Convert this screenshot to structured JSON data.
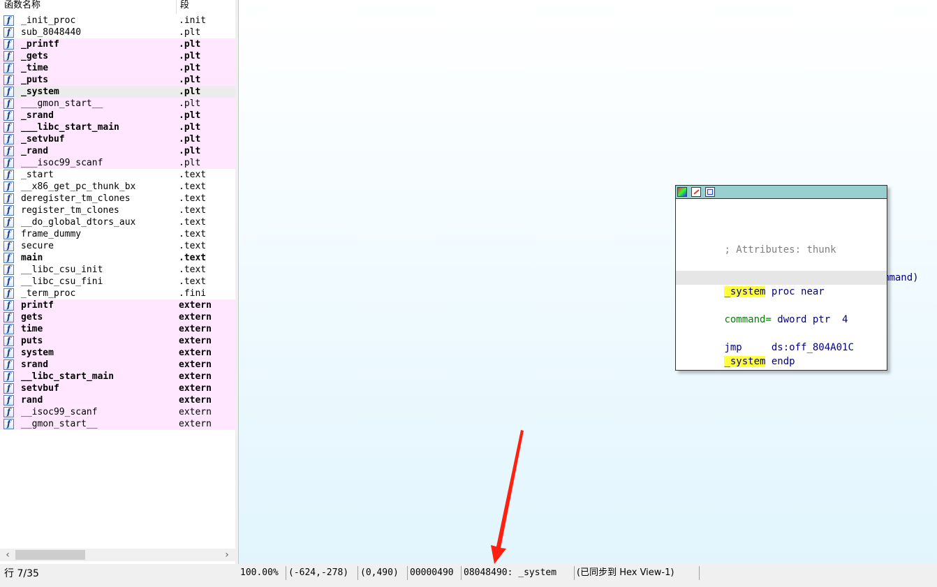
{
  "func_panel": {
    "header": {
      "name_col": "函数名称",
      "segment_col": "段"
    },
    "rows": [
      {
        "name": "_init_proc",
        "segment": ".init",
        "style": "normal"
      },
      {
        "name": "sub_8048440",
        "segment": ".plt",
        "style": "normal"
      },
      {
        "name": "_printf",
        "segment": ".plt",
        "style": "pink-bold"
      },
      {
        "name": "_gets",
        "segment": ".plt",
        "style": "pink-bold"
      },
      {
        "name": "_time",
        "segment": ".plt",
        "style": "pink-bold"
      },
      {
        "name": "_puts",
        "segment": ".plt",
        "style": "pink-bold"
      },
      {
        "name": "_system",
        "segment": ".plt",
        "style": "selected-bold"
      },
      {
        "name": "___gmon_start__",
        "segment": ".plt",
        "style": "pink"
      },
      {
        "name": "_srand",
        "segment": ".plt",
        "style": "pink-bold"
      },
      {
        "name": "___libc_start_main",
        "segment": ".plt",
        "style": "pink-bold"
      },
      {
        "name": "_setvbuf",
        "segment": ".plt",
        "style": "pink-bold"
      },
      {
        "name": "_rand",
        "segment": ".plt",
        "style": "pink-bold"
      },
      {
        "name": "___isoc99_scanf",
        "segment": ".plt",
        "style": "pink"
      },
      {
        "name": "_start",
        "segment": ".text",
        "style": "normal"
      },
      {
        "name": "__x86_get_pc_thunk_bx",
        "segment": ".text",
        "style": "normal"
      },
      {
        "name": "deregister_tm_clones",
        "segment": ".text",
        "style": "normal"
      },
      {
        "name": "register_tm_clones",
        "segment": ".text",
        "style": "normal"
      },
      {
        "name": "__do_global_dtors_aux",
        "segment": ".text",
        "style": "normal"
      },
      {
        "name": "frame_dummy",
        "segment": ".text",
        "style": "normal"
      },
      {
        "name": "secure",
        "segment": ".text",
        "style": "normal"
      },
      {
        "name": "main",
        "segment": ".text",
        "style": "bold"
      },
      {
        "name": "__libc_csu_init",
        "segment": ".text",
        "style": "normal"
      },
      {
        "name": "__libc_csu_fini",
        "segment": ".text",
        "style": "normal"
      },
      {
        "name": "_term_proc",
        "segment": ".fini",
        "style": "normal"
      },
      {
        "name": "printf",
        "segment": "extern",
        "style": "pink-bold"
      },
      {
        "name": "gets",
        "segment": "extern",
        "style": "pink-bold"
      },
      {
        "name": "time",
        "segment": "extern",
        "style": "pink-bold"
      },
      {
        "name": "puts",
        "segment": "extern",
        "style": "pink-bold"
      },
      {
        "name": "system",
        "segment": "extern",
        "style": "pink-bold"
      },
      {
        "name": "srand",
        "segment": "extern",
        "style": "pink-bold"
      },
      {
        "name": "__libc_start_main",
        "segment": "extern",
        "style": "pink-bold"
      },
      {
        "name": "setvbuf",
        "segment": "extern",
        "style": "pink-bold"
      },
      {
        "name": "rand",
        "segment": "extern",
        "style": "pink-bold"
      },
      {
        "name": "__isoc99_scanf",
        "segment": "extern",
        "style": "pink"
      },
      {
        "name": "__gmon_start__",
        "segment": "extern",
        "style": "pink"
      }
    ],
    "icon_glyph": "f",
    "row_status": "行 7/35",
    "scroll_left": "‹",
    "scroll_right": "›"
  },
  "code_node": {
    "attributes": "; Attributes: thunk",
    "signature": "; int system(const char *command)",
    "proc_name": "_system",
    "proc_kw": " proc near",
    "arg_name": "command=",
    "arg_type": " dword ptr  4",
    "jmp_op": "jmp",
    "jmp_target": "     ds:off_804A01C",
    "endp_name": "_system",
    "endp_kw": " endp"
  },
  "status_bar": {
    "zoom": "100.00%",
    "coords": "(-624,-278)",
    "pos": "(0,490)",
    "offset": "00000490",
    "address": "08048490: _system",
    "sync": "(已同步到 Hex View-1)"
  },
  "colors": {
    "pink_row": "#ffe8ff",
    "selected_row": "#ececec",
    "node_title": "#98d0d0",
    "highlight": "#ffff40",
    "arrow": "#ff2010"
  }
}
